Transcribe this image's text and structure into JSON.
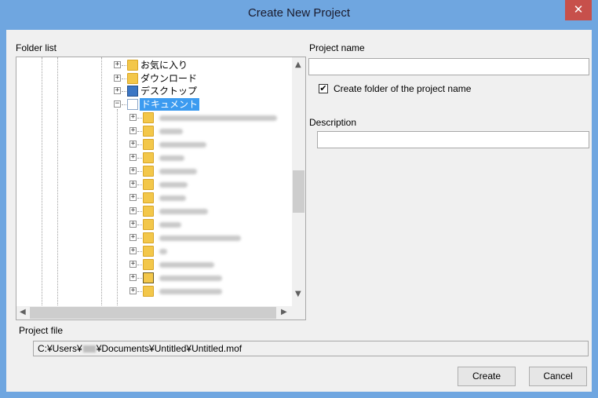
{
  "window": {
    "title": "Create New Project",
    "close_symbol": "✕"
  },
  "folder_list": {
    "label": "Folder list",
    "nodes": [
      {
        "label": "お気に入り",
        "icon": "star-folder-icon",
        "expander": "+"
      },
      {
        "label": "ダウンロード",
        "icon": "download-folder-icon",
        "expander": "+"
      },
      {
        "label": "デスクトップ",
        "icon": "desktop-folder-icon",
        "expander": "+"
      },
      {
        "label": "ドキュメント",
        "icon": "documents-folder-icon",
        "expander": "−",
        "selected": true
      }
    ],
    "child_count_blurred": 15,
    "scroll_up": "▲",
    "scroll_down": "▼",
    "scroll_left": "◀",
    "scroll_right": "▶"
  },
  "project_name": {
    "label": "Project name",
    "value": ""
  },
  "create_folder_checkbox": {
    "label": "Create folder of the project name",
    "checked": true,
    "mark": "✔"
  },
  "description": {
    "label": "Description",
    "value": ""
  },
  "project_file": {
    "label": "Project file",
    "path_prefix": "C:¥Users¥",
    "path_suffix": "¥Documents¥Untitled¥Untitled.mof"
  },
  "buttons": {
    "create": "Create",
    "cancel": "Cancel"
  },
  "colors": {
    "title_bar": "#6fa6e0",
    "close_button": "#c7504b",
    "selection": "#3c9bf0",
    "folder": "#f3c74a"
  }
}
